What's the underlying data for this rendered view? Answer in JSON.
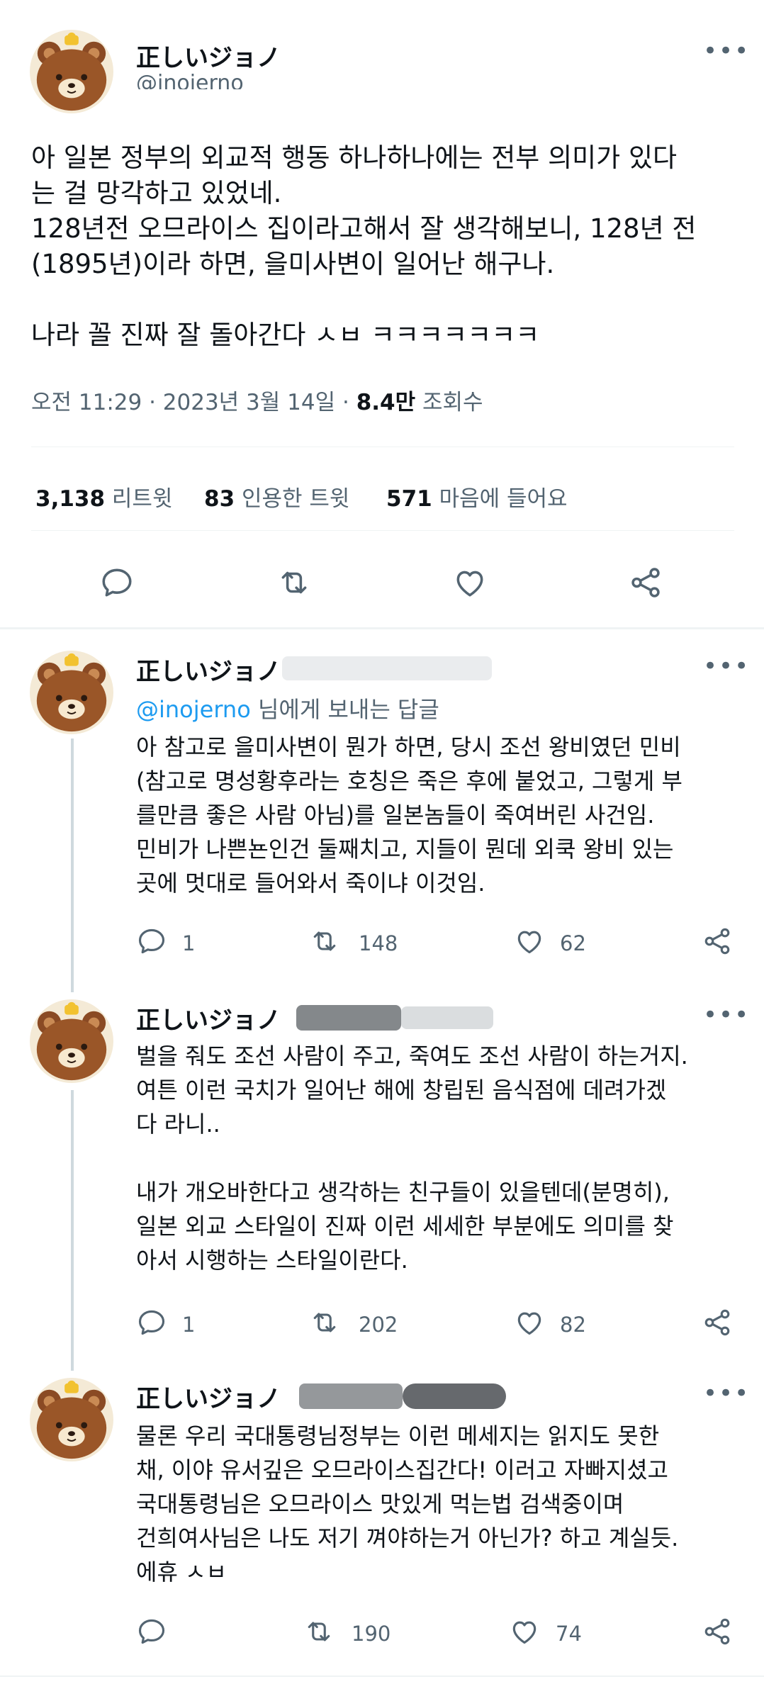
{
  "main_tweet": {
    "author_name": "正しいジョノ",
    "handle": "@inojerno",
    "text": "아 일본 정부의 외교적 행동 하나하나에는 전부 의미가 있다\n는 걸 망각하고 있었네.\n128년전 오므라이스 집이라고해서 잘 생각해보니, 128년 전\n(1895년)이라 하면, 을미사변이 일어난 해구나.\n\n나라 꼴 진짜 잘 돌아간다 ㅅㅂ ㅋㅋㅋㅋㅋㅋㅋ",
    "time": "오전 11:29 · 2023년 3월 14일 · ",
    "views_count": "8.4만",
    "views_label": " 조회수",
    "retweets_count": "3,138",
    "retweets_label": " 리트윗",
    "quotes_count": "83",
    "quotes_label": " 인용한 트윗",
    "likes_count": "571",
    "likes_label": " 마음에 들어요"
  },
  "replies": [
    {
      "author_name": "正しいジョノ",
      "replying_handle": "@inojerno",
      "replying_suffix": " 님에게 보내는 답글",
      "text": "아 참고로 을미사변이 뭔가 하면, 당시 조선 왕비였던 민비\n(참고로 명성황후라는 호칭은 죽은 후에 붙었고, 그렇게 부\n를만큼 좋은 사람 아님)를 일본놈들이 죽여버린 사건임.\n민비가 나쁜뇬인건 둘째치고, 지들이 뭔데 외쿡 왕비 있는\n곳에 멋대로 들어와서 죽이냐 이것임.",
      "reply_count": "1",
      "retweet_count": "148",
      "like_count": "62"
    },
    {
      "author_name": "正しいジョノ",
      "text": "벌을 줘도 조선 사람이 주고, 죽여도 조선 사람이 하는거지.\n여튼 이런 국치가 일어난 해에 창립된 음식점에 데려가겠\n다 라니..\n\n내가 개오바한다고 생각하는 친구들이 있을텐데(분명히),\n일본 외교 스타일이 진짜 이런 세세한 부분에도 의미를 찾\n아서 시행하는 스타일이란다.",
      "reply_count": "1",
      "retweet_count": "202",
      "like_count": "82"
    },
    {
      "author_name": "正しいジョノ",
      "text": "물론 우리 국대통령님정부는 이런 메세지는 읽지도 못한\n채, 이야 유서깊은 오므라이스집간다! 이러고 자빠지셨고\n국대통령님은 오므라이스 맛있게 먹는법 검색중이며\n건희여사님은 나도 저기 껴야하는거 아닌가? 하고 계실듯.\n에휴 ㅅㅂ",
      "reply_count": "",
      "retweet_count": "190",
      "like_count": "74"
    }
  ],
  "icons": {
    "more": "more-dots-icon",
    "reply": "reply-bubble-icon",
    "retweet": "retweet-arrows-icon",
    "like": "heart-icon",
    "share": "share-nodes-icon"
  },
  "colors": {
    "text": "#0f1419",
    "secondary": "#536471",
    "link": "#1d9bf0",
    "divider": "#eff3f4"
  }
}
